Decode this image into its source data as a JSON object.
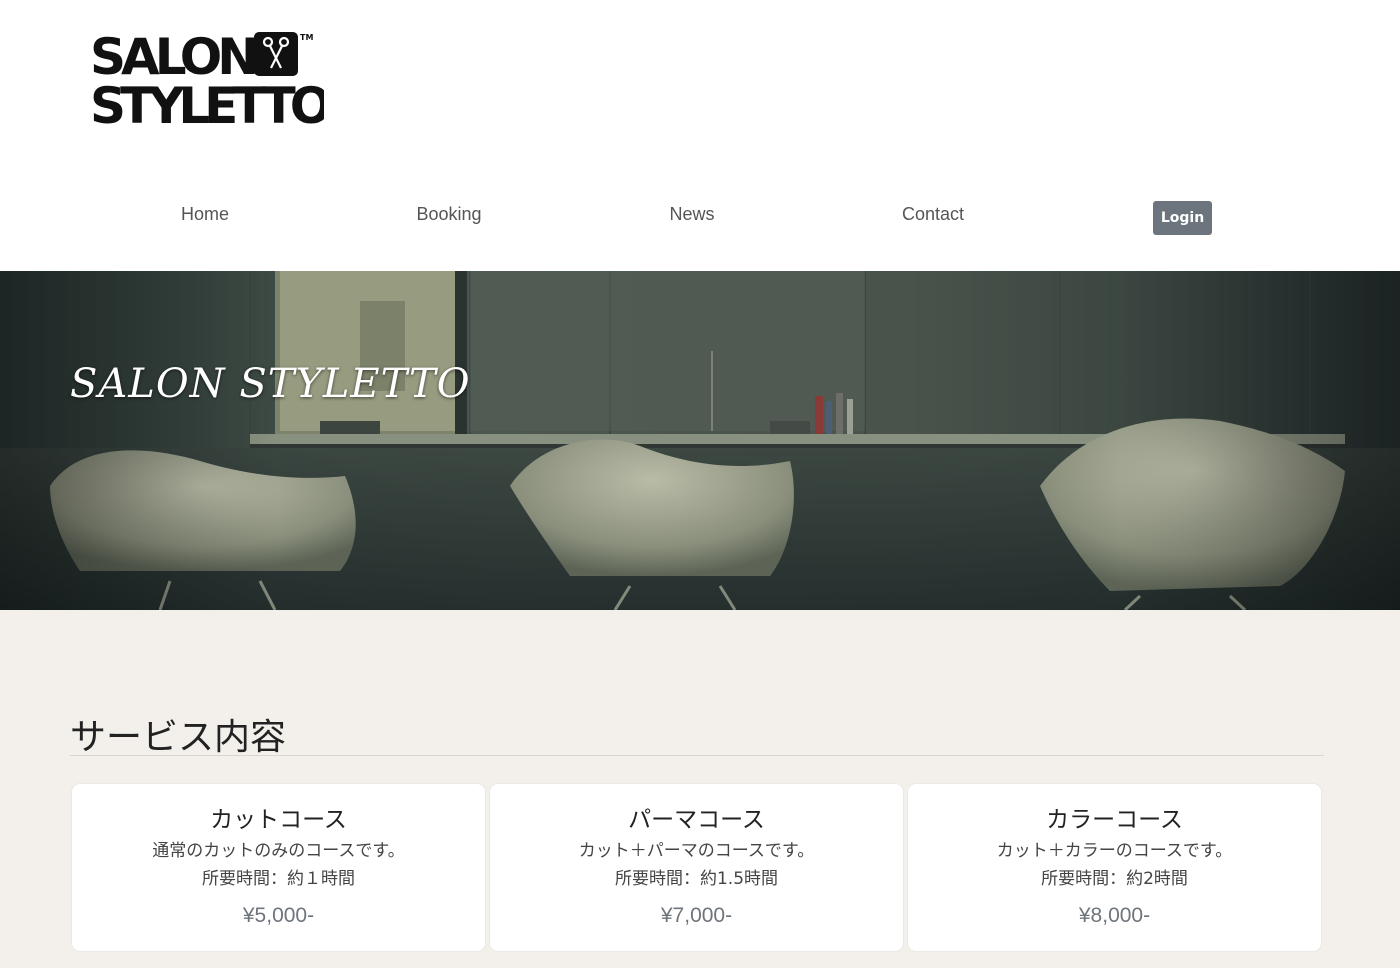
{
  "logo": {
    "line1": "SALON",
    "line2": "STYLETTO",
    "tm": "TM"
  },
  "nav": {
    "items": [
      {
        "label": "Home"
      },
      {
        "label": "Booking"
      },
      {
        "label": "News"
      },
      {
        "label": "Contact"
      }
    ],
    "login_label": "Login"
  },
  "hero": {
    "title": "SALON STYLETTO"
  },
  "services": {
    "heading": "サービス内容",
    "cards": [
      {
        "title": "カットコース",
        "description": "通常のカットのみのコースです。",
        "duration": "所要時間：約１時間",
        "price": "¥5,000-"
      },
      {
        "title": "パーマコース",
        "description": "カット＋パーマのコースです。",
        "duration": "所要時間：約1.5時間",
        "price": "¥7,000-"
      },
      {
        "title": "カラーコース",
        "description": "カット＋カラーのコースです。",
        "duration": "所要時間：約2時間",
        "price": "¥8,000-"
      }
    ]
  },
  "colors": {
    "login_button": "#6c757d",
    "section_background": "#f3f0ec",
    "price_text": "#6f757c"
  }
}
